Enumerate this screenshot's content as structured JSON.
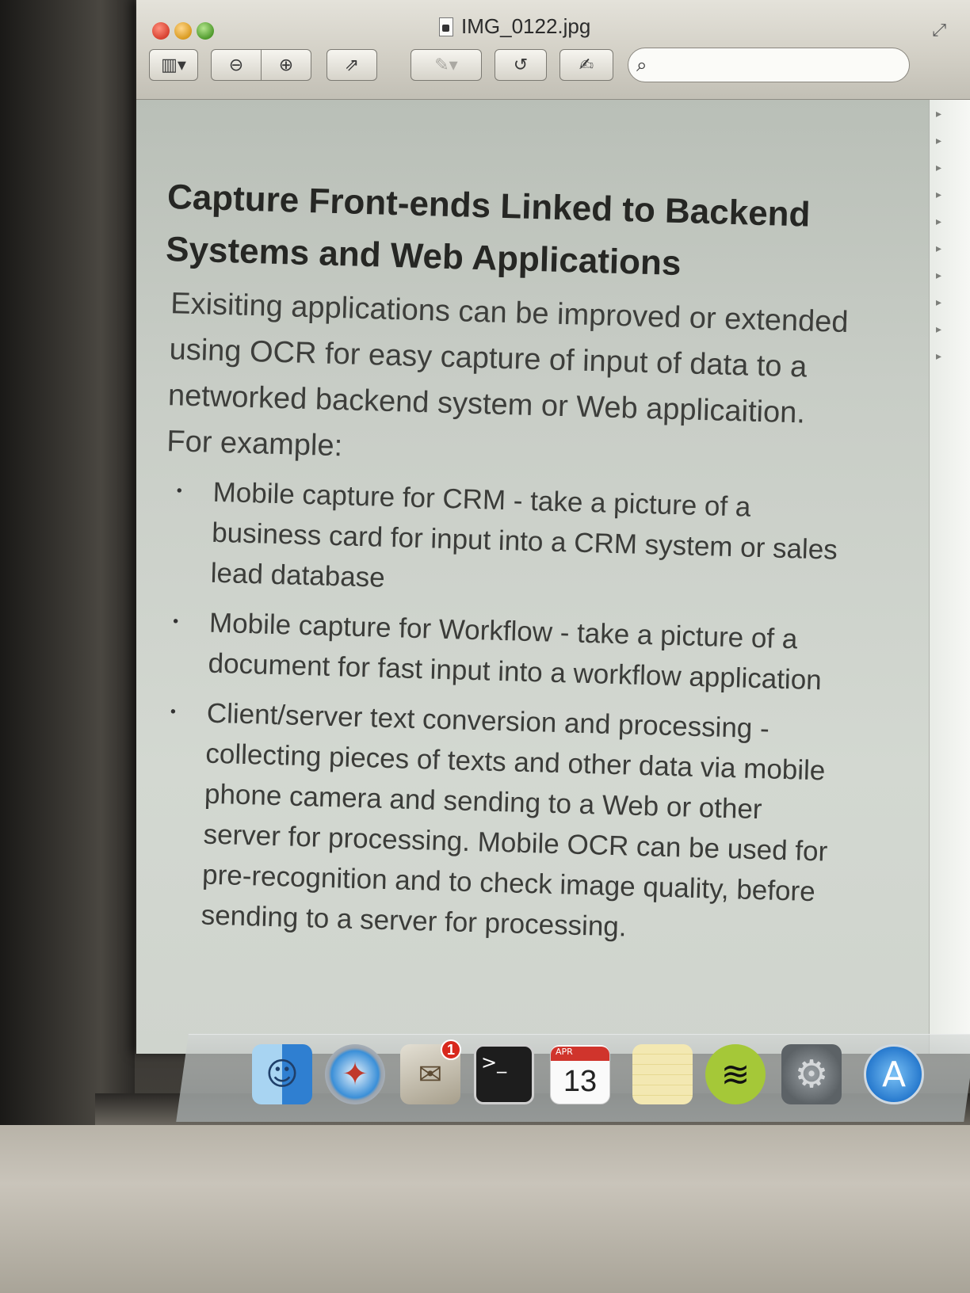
{
  "window": {
    "title": "IMG_0122.jpg"
  },
  "toolbar": {
    "sidebar_icon": "sidebar-toggle-icon",
    "zoom_out_icon": "zoom-out-icon",
    "zoom_in_icon": "zoom-in-icon",
    "share_icon": "share-icon",
    "markup_icon": "pen-icon",
    "rotate_icon": "rotate-icon",
    "edit_icon": "edit-toolbar-icon",
    "search_placeholder": ""
  },
  "document": {
    "heading": "Capture Front-ends Linked to Backend Systems and Web Applications",
    "intro": "Exisiting applications can be improved or extended using OCR for easy capture of input of data to a networked backend system or Web applicaition. For example:",
    "bullets": [
      "Mobile capture  for CRM - take a picture of a business card for input into a CRM system or sales lead database",
      "Mobile capture  for Workflow - take a picture of a document for fast input into a workflow  application",
      "Client/server text conversion and processing - collecting pieces of texts and other data via mobile  phone camera and sending to a Web or other server for processing. Mobile  OCR can be used for pre-recognition and to check image quality, before sending to a server  for processing."
    ]
  },
  "dock": {
    "apps": [
      "Finder",
      "Safari",
      "Mail",
      "Terminal",
      "Calendar",
      "Notes",
      "Spotify",
      "System Preferences",
      "App Store"
    ],
    "mail_badge": "1",
    "calendar_month": "APR",
    "calendar_day": "13"
  },
  "colors": {
    "close": "#d7402f",
    "minimize": "#d99a1f",
    "zoom": "#4f9a2c",
    "mail_badge": "#d8281c"
  }
}
